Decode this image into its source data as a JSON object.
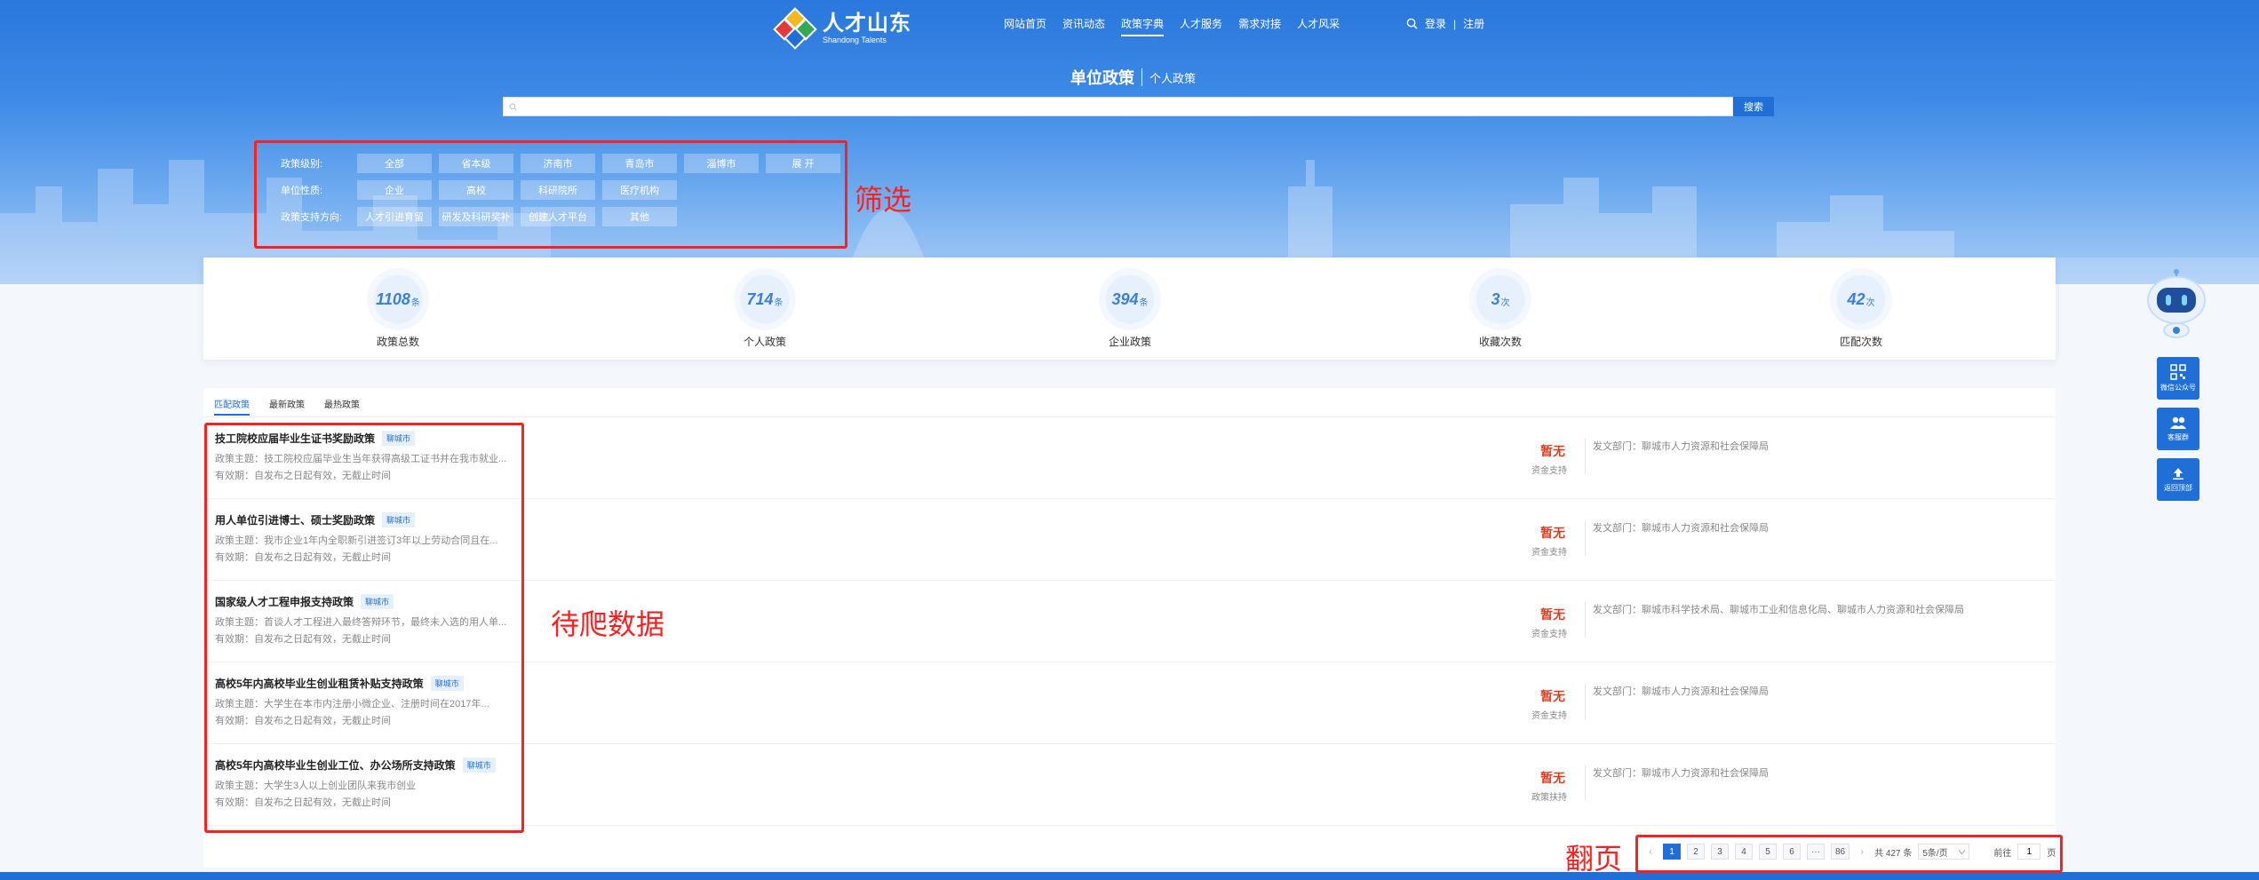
{
  "brand": {
    "logo_cn": "人才山东",
    "logo_en": "Shandong Talents"
  },
  "nav": {
    "items": [
      "网站首页",
      "资讯动态",
      "政策字典",
      "人才服务",
      "需求对接",
      "人才风采"
    ],
    "active_index": 2
  },
  "auth": {
    "login": "登录",
    "separator": "|",
    "register": "注册"
  },
  "page_tabs": {
    "unit": "单位政策",
    "personal": "个人政策"
  },
  "search": {
    "value": "",
    "button": "搜索"
  },
  "filters": [
    {
      "label": "政策级别:",
      "options": [
        "全部",
        "省本级",
        "济南市",
        "青岛市",
        "淄博市",
        "展 开"
      ]
    },
    {
      "label": "单位性质:",
      "options": [
        "企业",
        "高校",
        "科研院所",
        "医疗机构"
      ]
    },
    {
      "label": "政策支持方向:",
      "options": [
        "人才引进育留",
        "研发及科研奖补",
        "创建人才平台",
        "其他"
      ]
    }
  ],
  "annotations": {
    "filter": "筛选",
    "data": "待爬数据",
    "pager": "翻页",
    "color": "#ff1f1f"
  },
  "stats": [
    {
      "value": "1108",
      "unit": "条",
      "label": "政策总数"
    },
    {
      "value": "714",
      "unit": "条",
      "label": "个人政策"
    },
    {
      "value": "394",
      "unit": "条",
      "label": "企业政策"
    },
    {
      "value": "3",
      "unit": "次",
      "label": "收藏次数"
    },
    {
      "value": "42",
      "unit": "次",
      "label": "匹配次数"
    }
  ],
  "list_tabs": [
    "匹配政策",
    "最新政策",
    "最热政策"
  ],
  "policies": [
    {
      "title": "技工院校应届毕业生证书奖励政策",
      "tag": "聊城市",
      "subject": "政策主题：技工院校应届毕业生当年获得高级工证书并在我市就业...",
      "validity": "有效期：自发布之日起有效，无截止时间",
      "amount": "暂无",
      "kind": "资金支持",
      "dept": "发文部门：聊城市人力资源和社会保障局"
    },
    {
      "title": "用人单位引进博士、硕士奖励政策",
      "tag": "聊城市",
      "subject": "政策主题：我市企业1年内全职新引进签订3年以上劳动合同且在...",
      "validity": "有效期：自发布之日起有效，无截止时间",
      "amount": "暂无",
      "kind": "资金支持",
      "dept": "发文部门：聊城市人力资源和社会保障局"
    },
    {
      "title": "国家级人才工程申报支持政策",
      "tag": "聊城市",
      "subject": "政策主题：首谈人才工程进入最终答辩环节，最终未入选的用人单...",
      "validity": "有效期：自发布之日起有效，无截止时间",
      "amount": "暂无",
      "kind": "资金支持",
      "dept": "发文部门：聊城市科学技术局、聊城市工业和信息化局、聊城市人力资源和社会保障局"
    },
    {
      "title": "高校5年内高校毕业生创业租赁补贴支持政策",
      "tag": "聊城市",
      "subject": "政策主题：大学生在本市内注册小微企业、注册时间在2017年...",
      "validity": "有效期：自发布之日起有效，无截止时间",
      "amount": "暂无",
      "kind": "资金支持",
      "dept": "发文部门：聊城市人力资源和社会保障局"
    },
    {
      "title": "高校5年内高校毕业生创业工位、办公场所支持政策",
      "tag": "聊城市",
      "subject": "政策主题：大学生3人以上创业团队来我市创业",
      "validity": "有效期：自发布之日起有效，无截止时间",
      "amount": "暂无",
      "kind": "政策扶持",
      "dept": "发文部门：聊城市人力资源和社会保障局"
    }
  ],
  "pagination": {
    "prev": "‹",
    "next": "›",
    "pages": [
      "1",
      "2",
      "3",
      "4",
      "5",
      "6",
      "···",
      "86"
    ],
    "current": "1",
    "total": "共 427 条",
    "page_size": "5条/页",
    "goto_label": "前往",
    "goto_value": "1",
    "page_suffix": "页"
  },
  "side": {
    "wechat": "微信公众号",
    "service": "客服群",
    "top": "返回顶部"
  },
  "colors": {
    "primary": "#1f6fd6",
    "hero": "#3d8ae6",
    "amount": "#e03c1f"
  }
}
